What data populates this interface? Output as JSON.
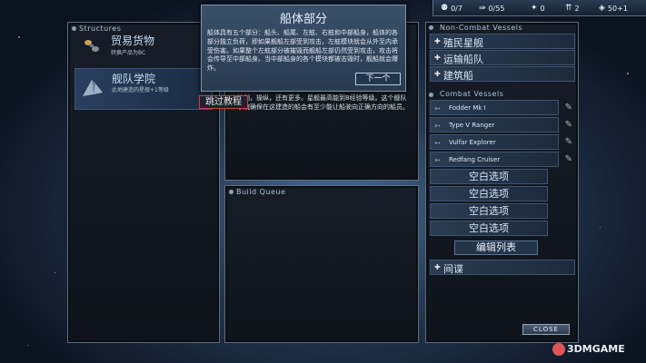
{
  "topbar": {
    "crew": "0/7",
    "vessels": "0/55",
    "research": "0",
    "missiles": "2",
    "credits": "50+1"
  },
  "structures": {
    "title": "Structures",
    "items": [
      {
        "label": "贸易货物",
        "desc": "转换产品为BC"
      },
      {
        "label": "舰队学院",
        "desc": "此地建造的星舰+1等级"
      }
    ]
  },
  "popup": {
    "title": "船体部分",
    "body": "船体具有五个部分：船头、船尾、左舷、右舷和中部船身，船体的各部分独立负荷，即如果舰船左部受到攻击，左舷模块就会从外至内承受伤害。如果整个左舷部分被摧毁而舰船左部仍然受到攻击，攻击将会传导至中部船身。当中部船身的各个模块都被击毁时，舰船就会爆炸。",
    "next": "下一个"
  },
  "skip_button": "跳过教程",
  "mid_text": "控制，操纵，还有更多。星舰最高能到8经验等级。这个舰队学院确保在这建造的船会有至少能让船驶向正确方向的船员。",
  "build_queue": {
    "title": "Build Queue"
  },
  "non_combat": {
    "title": "Non-Combat Vessels",
    "items": [
      "殖民星舰",
      "运输船队",
      "建筑船"
    ]
  },
  "combat": {
    "title": "Combat Vessels",
    "items": [
      "Fodder Mk I",
      "Type V Ranger",
      "Vulfar Explorer",
      "Redfang Cruiser"
    ]
  },
  "empty_slots": [
    "空白选项",
    "空白选项",
    "空白选项",
    "空白选项"
  ],
  "edit_list": "编辑列表",
  "spy": "间谍",
  "close": "CLOSE",
  "watermark": "3DMGAME"
}
